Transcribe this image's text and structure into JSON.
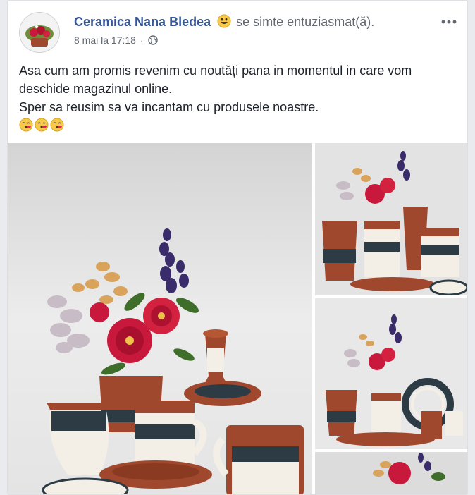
{
  "post": {
    "author": "Ceramica Nana Bledea",
    "feeling_text": "se simte entuziasmat(ă).",
    "feeling_icon": "smiling-face-icon",
    "timestamp": "8 mai la 17:18",
    "dot": "·",
    "privacy_icon": "globe-icon",
    "more_icon": "more-options-icon",
    "more_label": "•••",
    "content_lines": [
      "Asa cum am promis revenim cu noutăți pana in momentul in care vom",
      "deschide magazinul online.",
      "Sper sa reusim sa va incantam cu produsele noastre."
    ],
    "content_emojis": [
      "face-blowing-kiss-icon",
      "face-blowing-kiss-icon",
      "face-blowing-kiss-icon"
    ]
  },
  "photos": [
    {
      "name": "ceramic-set-photo-main",
      "icon": "ceramics-photo"
    },
    {
      "name": "ceramic-set-photo-2",
      "icon": "ceramics-photo"
    },
    {
      "name": "ceramic-set-photo-3",
      "icon": "ceramics-photo"
    },
    {
      "name": "ceramic-set-photo-4",
      "icon": "ceramics-photo"
    }
  ],
  "colors": {
    "link": "#365899",
    "text": "#1d2129",
    "secondary_text": "#606770",
    "terracotta": "#a0482e",
    "cream": "#f4efe6",
    "flower_red": "#c8193c",
    "lavender": "#3a2b6b"
  }
}
